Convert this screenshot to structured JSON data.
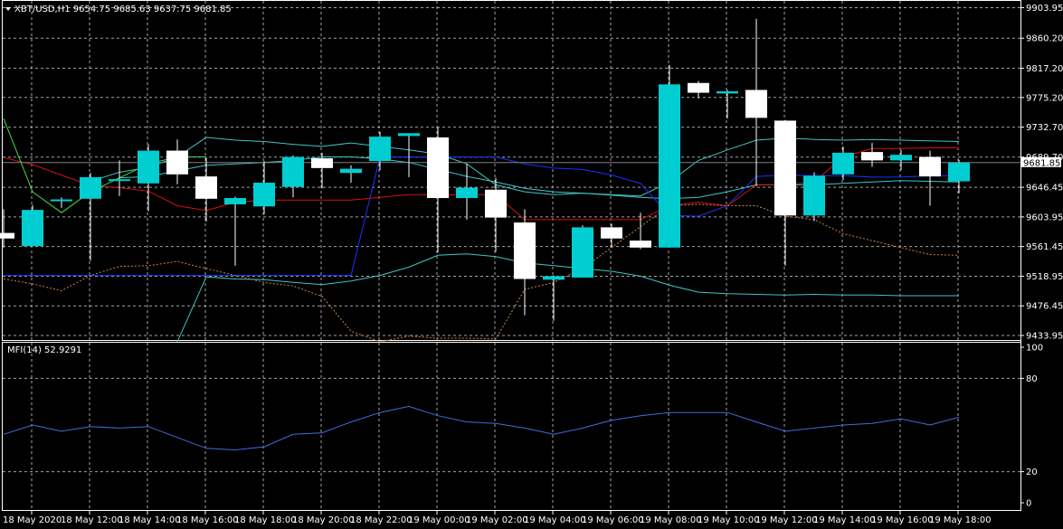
{
  "chart_data": [
    {
      "type": "candlestick",
      "title": "XBT/USD,H1  9654.75 9685.63 9637.75 9681.85",
      "symbol": "XBT/USD,H1",
      "ohlc_readout": [
        "9654.75",
        "9685.63",
        "9637.75",
        "9681.85"
      ],
      "last_price_label": "9681.85",
      "price_tick_labels": [
        "9903.95",
        "9860.20",
        "9817.20",
        "9775.20",
        "9732.70",
        "9689.70",
        "9646.45",
        "9603.95",
        "9561.45",
        "9518.95",
        "9476.45",
        "9433.95"
      ],
      "price_ticks": [
        9903.95,
        9860.2,
        9817.2,
        9775.2,
        9732.7,
        9689.7,
        9646.45,
        9603.95,
        9561.45,
        9518.95,
        9476.45,
        9433.95
      ],
      "ylim": [
        9433.95,
        9903.95
      ],
      "time_tick_labels": [
        "18 May 2020",
        "18 May 12:00",
        "18 May 14:00",
        "18 May 16:00",
        "18 May 18:00",
        "18 May 20:00",
        "18 May 22:00",
        "19 May 00:00",
        "19 May 02:00",
        "19 May 04:00",
        "19 May 06:00",
        "19 May 08:00",
        "19 May 10:00",
        "19 May 12:00",
        "19 May 14:00",
        "19 May 16:00",
        "19 May 18:00"
      ],
      "colors": {
        "bull": "#00ced1",
        "bear": "#ffffff",
        "wick": "#ffffff",
        "grid": "#c0c0c0",
        "axis": "#ffffff"
      },
      "grid": true,
      "candles": [
        {
          "o": 9581,
          "h": 9615,
          "l": 9560,
          "c": 9573
        },
        {
          "o": 9562,
          "h": 9621,
          "l": 9562,
          "c": 9614
        },
        {
          "o": 9627,
          "h": 9632,
          "l": 9617,
          "c": 9629
        },
        {
          "o": 9630,
          "h": 9667,
          "l": 9541,
          "c": 9661
        },
        {
          "o": 9656,
          "h": 9685,
          "l": 9634,
          "c": 9658
        },
        {
          "o": 9652,
          "h": 9708,
          "l": 9612,
          "c": 9699
        },
        {
          "o": 9699,
          "h": 9715,
          "l": 9651,
          "c": 9665
        },
        {
          "o": 9662,
          "h": 9689,
          "l": 9597,
          "c": 9630
        },
        {
          "o": 9622,
          "h": 9633,
          "l": 9534,
          "c": 9631
        },
        {
          "o": 9619,
          "h": 9684,
          "l": 9608,
          "c": 9653
        },
        {
          "o": 9647,
          "h": 9692,
          "l": 9632,
          "c": 9690
        },
        {
          "o": 9688,
          "h": 9696,
          "l": 9645,
          "c": 9674
        },
        {
          "o": 9667,
          "h": 9678,
          "l": 9653,
          "c": 9673
        },
        {
          "o": 9684,
          "h": 9726,
          "l": 9671,
          "c": 9719
        },
        {
          "o": 9720,
          "h": 9723,
          "l": 9661,
          "c": 9724
        },
        {
          "o": 9718,
          "h": 9732,
          "l": 9553,
          "c": 9631
        },
        {
          "o": 9631,
          "h": 9680,
          "l": 9600,
          "c": 9646
        },
        {
          "o": 9643,
          "h": 9660,
          "l": 9554,
          "c": 9603
        },
        {
          "o": 9596,
          "h": 9615,
          "l": 9463,
          "c": 9515
        },
        {
          "o": 9514,
          "h": 9520,
          "l": 9455,
          "c": 9519
        },
        {
          "o": 9517,
          "h": 9592,
          "l": 9517,
          "c": 9589
        },
        {
          "o": 9589,
          "h": 9594,
          "l": 9561,
          "c": 9573
        },
        {
          "o": 9570,
          "h": 9610,
          "l": 9558,
          "c": 9560
        },
        {
          "o": 9560,
          "h": 9822,
          "l": 9560,
          "c": 9794
        },
        {
          "o": 9796,
          "h": 9799,
          "l": 9774,
          "c": 9782
        },
        {
          "o": 9781,
          "h": 9786,
          "l": 9745,
          "c": 9784
        },
        {
          "o": 9786,
          "h": 9888,
          "l": 9648,
          "c": 9746
        },
        {
          "o": 9742,
          "h": 9743,
          "l": 9534,
          "c": 9606
        },
        {
          "o": 9606,
          "h": 9668,
          "l": 9598,
          "c": 9663
        },
        {
          "o": 9665,
          "h": 9705,
          "l": 9657,
          "c": 9696
        },
        {
          "o": 9697,
          "h": 9710,
          "l": 9676,
          "c": 9685
        },
        {
          "o": 9685,
          "h": 9700,
          "l": 9671,
          "c": 9693
        },
        {
          "o": 9690,
          "h": 9699,
          "l": 9620,
          "c": 9662
        },
        {
          "o": 9655,
          "h": 9686,
          "l": 9638,
          "c": 9682
        }
      ],
      "bollinger_upper": [
        null,
        null,
        null,
        9655,
        9668,
        9675,
        9690,
        9718,
        9714,
        9712,
        9708,
        9705,
        9710,
        9705,
        9700,
        9694,
        9680,
        9650,
        9640,
        9636,
        9638,
        9636,
        9634,
        9654,
        9685,
        9700,
        9714,
        9717,
        9715,
        9714,
        9715,
        9714,
        9713,
        9712
      ],
      "bollinger_middle": [
        null,
        null,
        null,
        null,
        9660,
        9662,
        9670,
        9678,
        9680,
        9682,
        9685,
        9690,
        9690,
        9687,
        9682,
        9672,
        9662,
        9654,
        9645,
        9640,
        9638,
        9635,
        9632,
        9630,
        9632,
        9640,
        9650,
        9650,
        9650,
        9652,
        9654,
        9656,
        9655,
        9654
      ],
      "bollinger_lower": [
        null,
        null,
        null,
        null,
        null,
        null,
        9425,
        9518,
        9515,
        9514,
        9510,
        9507,
        9512,
        9520,
        9532,
        9549,
        9551,
        9547,
        9538,
        9534,
        9530,
        9526,
        9519,
        9506,
        9496,
        9494,
        9493,
        9492,
        9493,
        9492,
        9492,
        9491,
        9491,
        9491
      ],
      "blue_line": [
        9520,
        9520,
        9520,
        9520,
        9520,
        9520,
        9520,
        9520,
        9520,
        9520,
        9520,
        9520,
        9520,
        9690,
        9690,
        9690,
        9690,
        9690,
        9680,
        9674,
        9672,
        9664,
        9652,
        9606,
        9605,
        9620,
        9662,
        9664,
        9663,
        9663,
        9661,
        9661,
        9663,
        9663
      ],
      "red_line": [
        9689,
        9679,
        9664,
        9649,
        9646,
        9641,
        9620,
        9613,
        9625,
        9628,
        9628,
        9628,
        9628,
        9632,
        9636,
        9636,
        9636,
        9636,
        9600,
        9600,
        9600,
        9600,
        9600,
        9620,
        9625,
        9620,
        9650,
        9650,
        9654,
        9690,
        9702,
        9702,
        9703,
        9703
      ],
      "dotted_line": [
        9515,
        9508,
        9498,
        9520,
        9533,
        9534,
        9540,
        9530,
        9520,
        9510,
        9505,
        9490,
        9440,
        9425,
        9433,
        9430,
        9430,
        9429,
        9500,
        9510,
        9530,
        9560,
        9590,
        9620,
        9622,
        9620,
        9620,
        9605,
        9600,
        9580,
        9570,
        9560,
        9550,
        9549
      ],
      "green_line": [
        9745,
        9640,
        9610,
        9640,
        9660,
        9680,
        9690,
        9690
      ],
      "mfi": {
        "label": "MFI(14) 52.9291",
        "value": 52.9291,
        "ylim": [
          0,
          100
        ],
        "tick_labels": [
          "100",
          "80",
          "20",
          "0"
        ],
        "ticks": [
          100,
          80,
          20,
          0
        ],
        "values": [
          44,
          50,
          46,
          49,
          48,
          49,
          42,
          35,
          34,
          36,
          44,
          45,
          52,
          58,
          62,
          56,
          52,
          51,
          48,
          44,
          48,
          53,
          56,
          58,
          58,
          58,
          52,
          46,
          48,
          50,
          51,
          54,
          50,
          55
        ]
      }
    }
  ]
}
